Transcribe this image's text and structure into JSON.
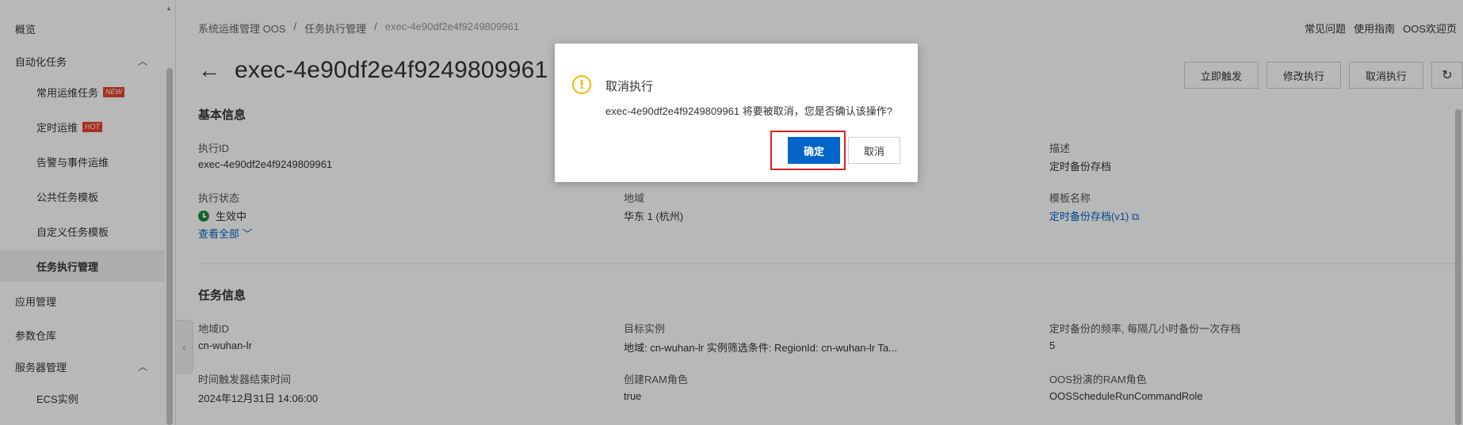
{
  "sidebar": {
    "items": [
      {
        "label": "概览"
      },
      {
        "label": "自动化任务"
      },
      {
        "label": "常用运维任务",
        "badge": "NEW"
      },
      {
        "label": "定时运维",
        "badge": "HOT"
      },
      {
        "label": "告警与事件运维"
      },
      {
        "label": "公共任务模板"
      },
      {
        "label": "自定义任务模板"
      },
      {
        "label": "任务执行管理"
      },
      {
        "label": "应用管理"
      },
      {
        "label": "参数仓库"
      },
      {
        "label": "服务器管理"
      },
      {
        "label": "ECS实例"
      }
    ]
  },
  "breadcrumb": [
    "系统运维管理 OOS",
    "/",
    "任务执行管理",
    "/",
    "exec-4e90df2e4f9249809961"
  ],
  "top_links": [
    "常见问题",
    "使用指南",
    "OOS欢迎页"
  ],
  "page": {
    "title": "exec-4e90df2e4f9249809961",
    "actions": [
      "立即触发",
      "修改执行",
      "取消执行"
    ]
  },
  "basic_info": {
    "title": "基本信息",
    "exec_id_label": "执行ID",
    "exec_id_value": "exec-4e90df2e4f9249809961",
    "description_label": "描述",
    "description_value": "定时备份存档",
    "status_label": "执行状态",
    "status_value": "生效中",
    "region_label": "地域",
    "region_value": "华东 1 (杭州)",
    "template_label": "模板名称",
    "template_value": "定时备份存档(v1)",
    "view_all": "查看全部"
  },
  "task_info": {
    "title": "任务信息",
    "region_id_label": "地域ID",
    "region_id_value": "cn-wuhan-lr",
    "target_label": "目标实例",
    "target_value": "地域: cn-wuhan-lr 实例筛选条件: RegionId: cn-wuhan-lr Ta...",
    "freq_label": "定时备份的频率, 每隔几小时备份一次存档",
    "freq_value": "5",
    "end_time_label": "时间触发器结束时间",
    "end_time_value": "2024年12月31日 14:06:00",
    "create_role_label": "创建RAM角色",
    "create_role_value": "true",
    "oos_role_label": "OOS扮演的RAM角色",
    "oos_role_value": "OOSScheduleRunCommandRole"
  },
  "modal": {
    "title": "取消执行",
    "message": "exec-4e90df2e4f9249809961 将要被取消，您是否确认该操作?",
    "ok": "确定",
    "cancel": "取消"
  }
}
